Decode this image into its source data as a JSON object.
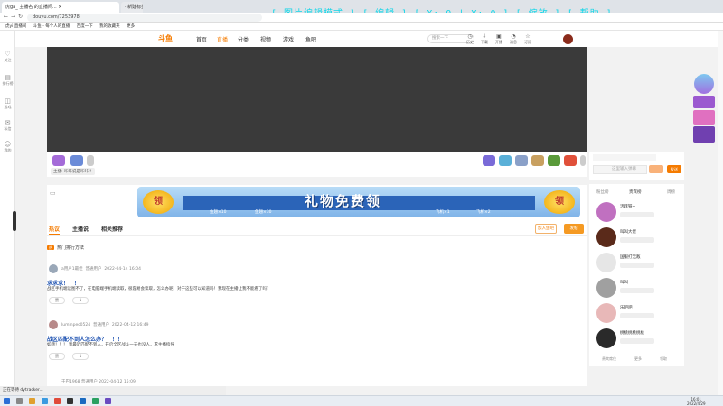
{
  "browser": {
    "tab1": "虎ga_ 主播名 的直播间... ×",
    "tab2": "· 新建标签页 × · ",
    "overlay": "[ 图片编辑模式 ] [ 编辑 ] [ X: 0 | Y: 0 ] [ 缩放 ] [ 帮助 ]",
    "url": "douyu.com/7253978",
    "bookmarks": [
      "虎yi 直播间",
      "斗鱼 - 每个人的直播",
      "百度一下",
      "我的收藏夹",
      "更多"
    ]
  },
  "left_rail": {
    "items": [
      "关注",
      "排行榜",
      "游戏",
      "私信",
      "我的"
    ]
  },
  "site": {
    "logo": "斗鱼",
    "nav": [
      "首页",
      "直播",
      "分类",
      "视频",
      "游戏",
      "鱼吧"
    ],
    "search_placeholder": "搜索一下",
    "header_icons": [
      "历史",
      "下载",
      "开播",
      "消息",
      "订阅"
    ]
  },
  "player": {
    "notice": "主播: 咔咔说是咔咔!!"
  },
  "banner": {
    "title": "礼物免费领",
    "coin_left": "领",
    "coin_right": "领",
    "sub_labels": [
      "鱼翅×10",
      "鱼翅×30",
      "飞机×1",
      "飞机×2"
    ]
  },
  "content": {
    "tabs": [
      "热议",
      "主播说",
      "相关推荐"
    ],
    "btn_outline": "加入鱼吧",
    "btn_fill": "发帖",
    "topic_tag": "热",
    "topic": "热门排行方法",
    "posts": [
      {
        "user": "a用户1最佳",
        "badge": "普通用户",
        "time": "2022-04-14 16:04",
        "title": "求求求！！！",
        "body": "战区手机端读图不了，在电脑端手机端读取，很容易会读取，怎么办呢，对于这些可以知道吗！我现在主播让我不能看了吗？",
        "like": "赞",
        "reply": "1"
      },
      {
        "user": "luminpec0524",
        "badge": "普通用户",
        "time": "2022-04-12 16:49",
        "title": "战区匹配不到人怎么办？！！！",
        "body": "如题！！！ 我最近匹配不到人，开启全区战斗一天也没人，求主播指导",
        "like": "赞",
        "reply": "1"
      }
    ],
    "next_meta": "干巴1968  普通用户  2022-04-12 15:09"
  },
  "right_panel": {
    "input_placeholder": "这里输入弹幕",
    "send": "发送",
    "tabs": [
      "粉丝榜",
      "贵宾榜",
      "周榜"
    ],
    "users": [
      "活跃铁~",
      "叫叫大佬",
      "国服打无敌",
      "叫叫",
      "乐吧吧",
      "桃桃桃桃桃桃"
    ],
    "footer": [
      "贵宾席位",
      "更多",
      "领取"
    ]
  },
  "status_text": "正在等待 dytracker...",
  "clock": {
    "time": "16:01",
    "date": "2022/4/29"
  },
  "colors": {
    "accent": "#f57b00",
    "player_bg": "#3a3a3a",
    "banner_blue": "#2b64b8"
  }
}
